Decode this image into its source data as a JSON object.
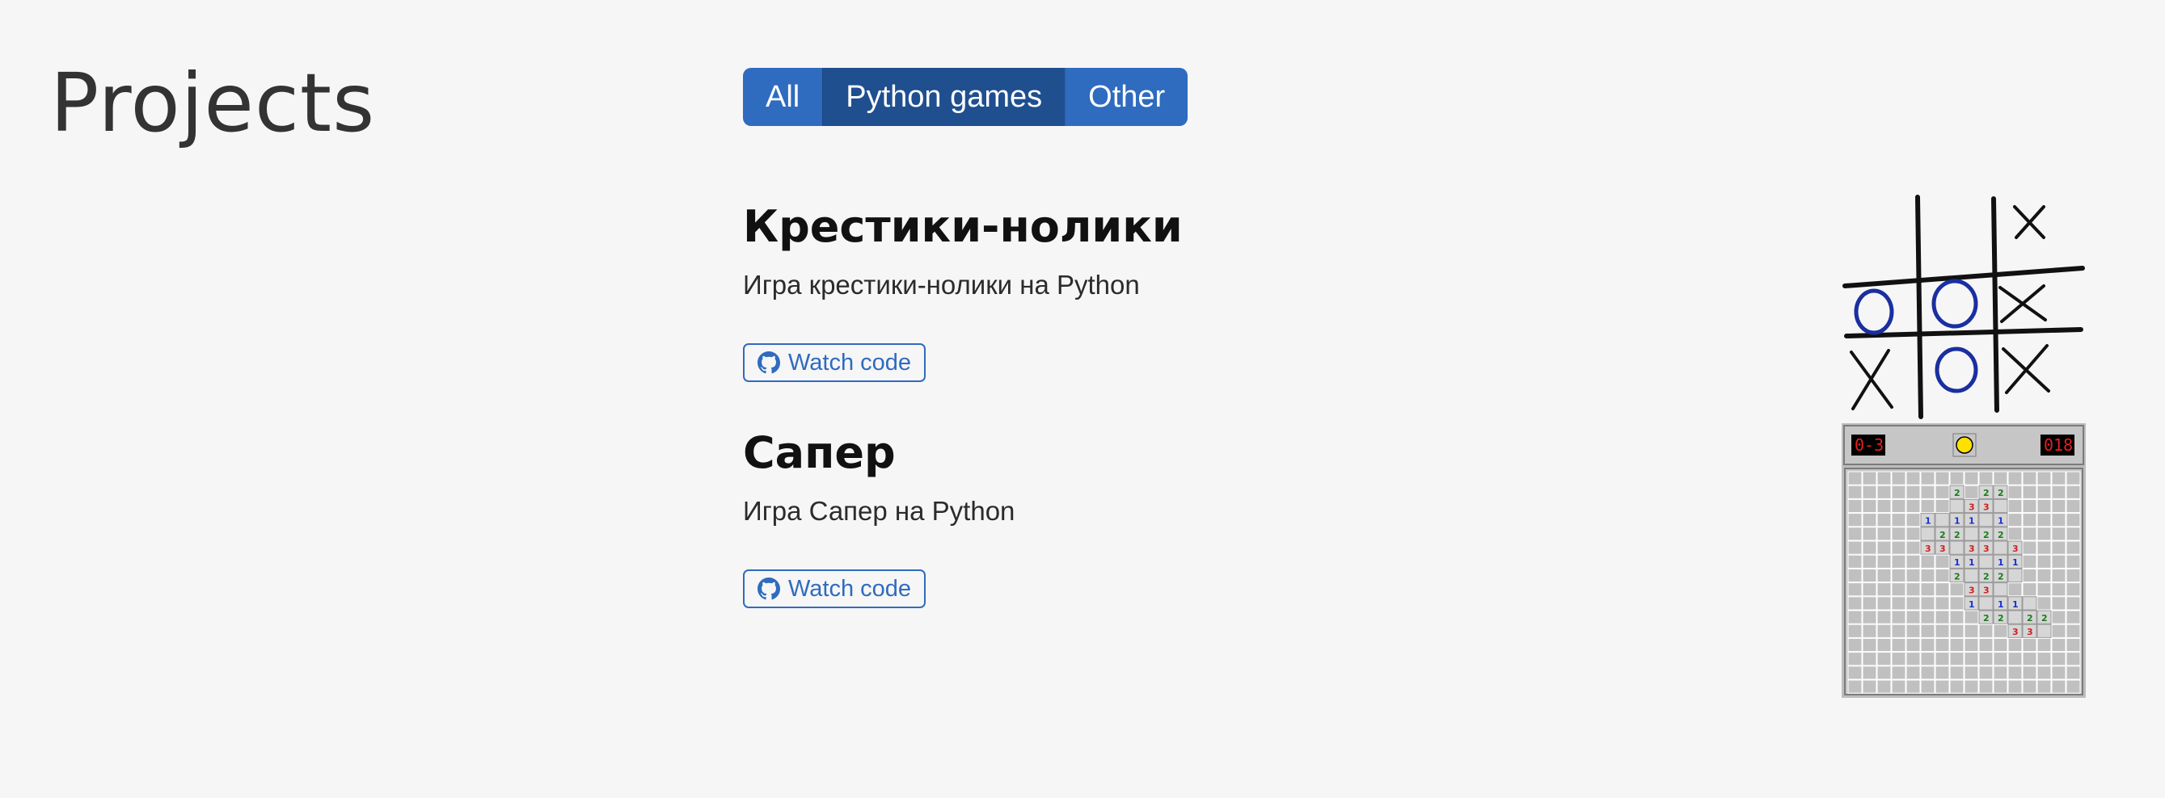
{
  "page": {
    "title": "Projects"
  },
  "filters": {
    "items": [
      {
        "label": "All",
        "active": false
      },
      {
        "label": "Python games",
        "active": true
      },
      {
        "label": "Other",
        "active": false
      }
    ]
  },
  "projects": [
    {
      "title": "Крестики-нолики",
      "description": "Игра крестики-нолики на Python",
      "button_label": "Watch code",
      "icon": "github-icon"
    },
    {
      "title": "Сапер",
      "description": "Игра Сапер на Python",
      "button_label": "Watch code",
      "icon": "github-icon"
    }
  ],
  "colors": {
    "background": "#f6f6f6",
    "accent": "#2f6bbf",
    "accent_active": "#1f4f8f"
  }
}
